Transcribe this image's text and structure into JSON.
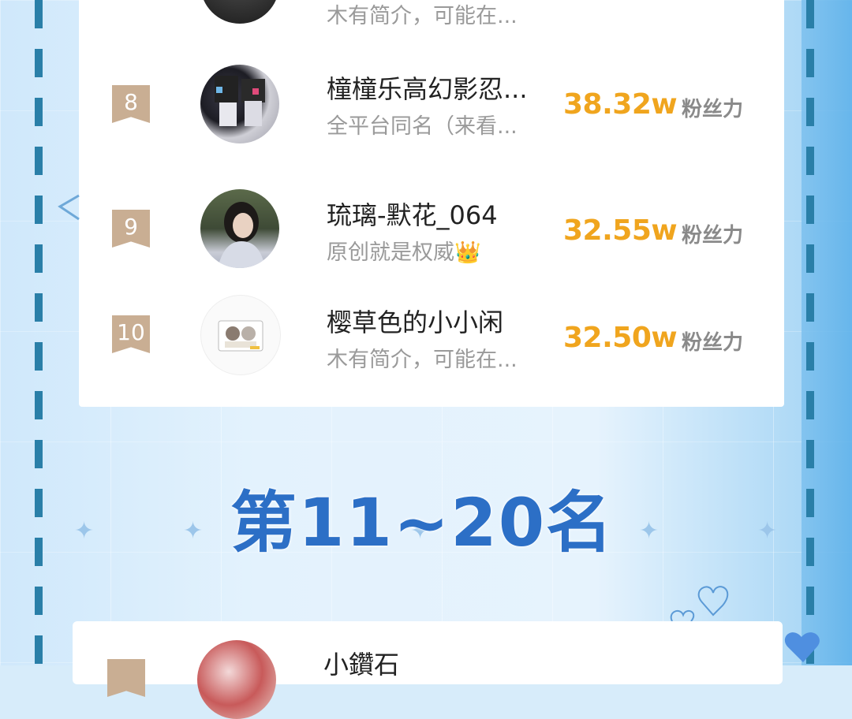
{
  "ranking": {
    "entries": [
      {
        "rank": "",
        "name": "",
        "intro": "木有简介，可能在...",
        "score": "",
        "unit": ""
      },
      {
        "rank": "8",
        "name": "橦橦乐高幻影忍...",
        "intro": "全平台同名（来看...",
        "score": "38.32w",
        "unit": "粉丝力"
      },
      {
        "rank": "9",
        "name": "琉璃-默花_064",
        "intro": "原创就是权威👑",
        "score": "32.55w",
        "unit": "粉丝力"
      },
      {
        "rank": "10",
        "name": "樱草色的小小闲",
        "intro": "木有简介，可能在...",
        "score": "32.50w",
        "unit": "粉丝力"
      }
    ]
  },
  "section": {
    "title": "第11~20名"
  },
  "next_card": {
    "first_name": "小鑽石"
  },
  "colors": {
    "score": "#f0a51e",
    "badge": "#c9ae93",
    "title": "#2c6fc6"
  }
}
